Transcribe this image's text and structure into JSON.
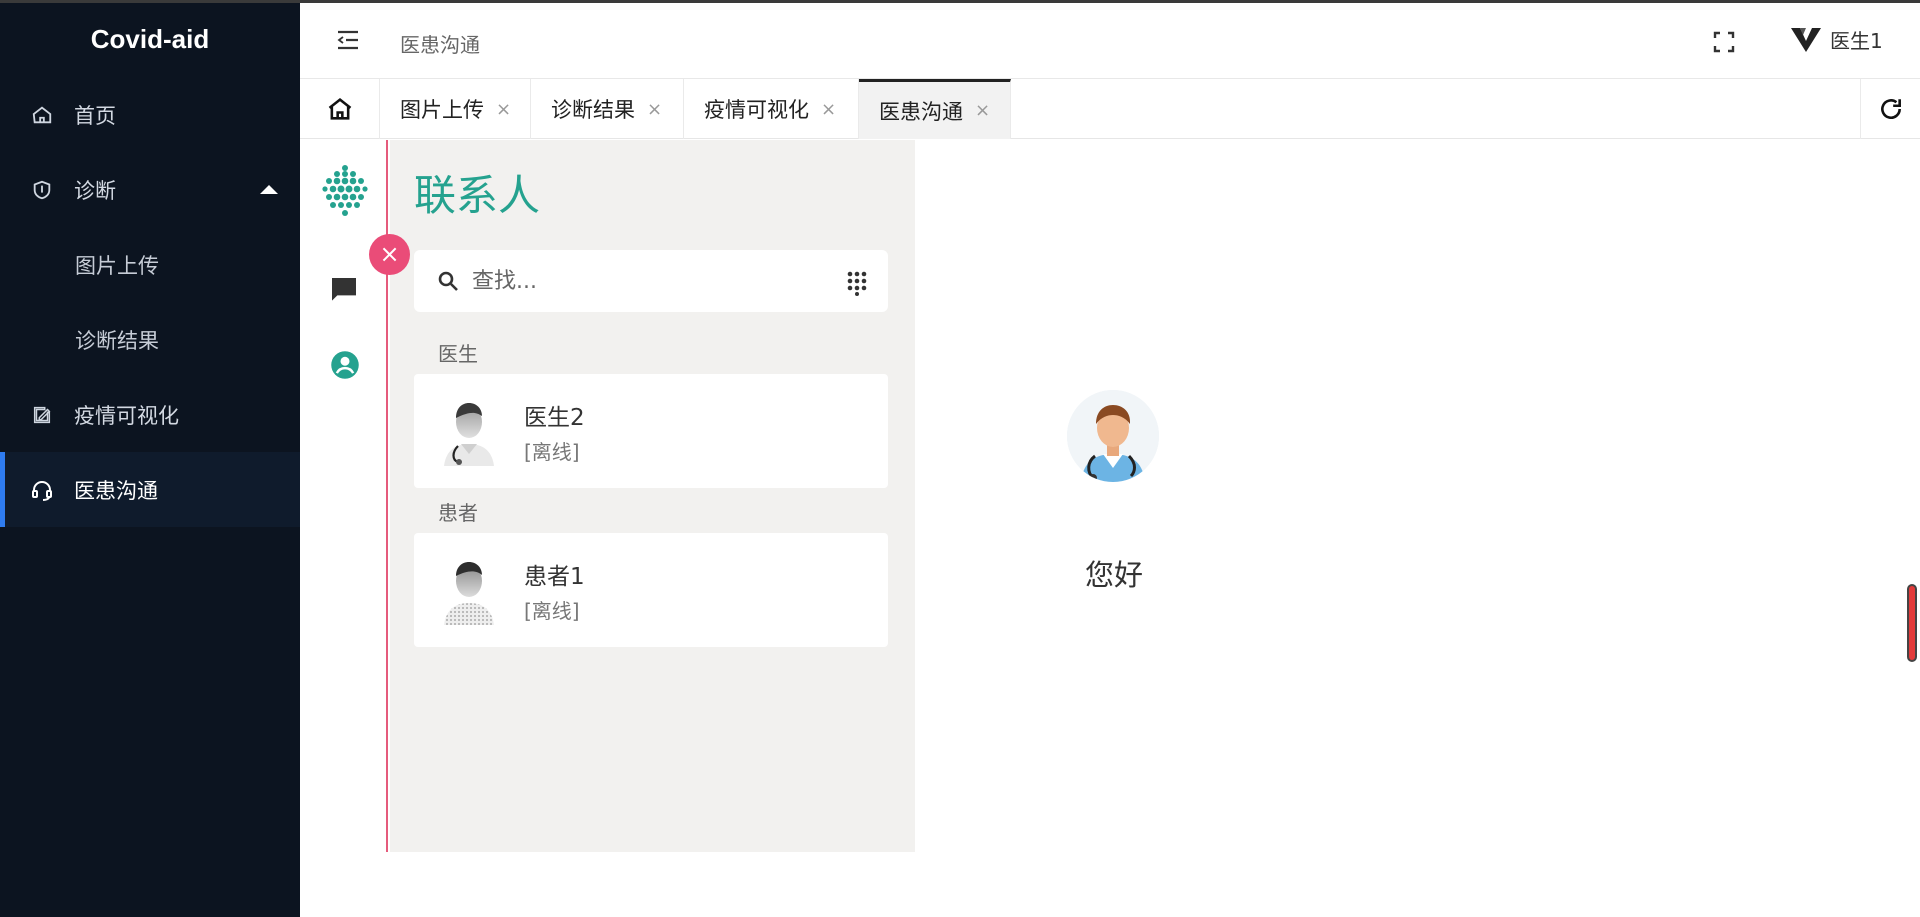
{
  "app": {
    "brand": "Covid-aid"
  },
  "sidebar": {
    "items": [
      {
        "label": "首页",
        "icon": "home-icon"
      },
      {
        "label": "诊断",
        "icon": "shield-icon",
        "expanded": true
      },
      {
        "label": "图片上传",
        "sub": true
      },
      {
        "label": "诊断结果",
        "sub": true
      },
      {
        "label": "疫情可视化",
        "icon": "chart-edit-icon"
      },
      {
        "label": "医患沟通",
        "icon": "headset-icon",
        "active": true
      }
    ]
  },
  "header": {
    "breadcrumb": "医患沟通",
    "user_name": "医生1"
  },
  "tabs": [
    {
      "label": "图片上传"
    },
    {
      "label": "诊断结果"
    },
    {
      "label": "疫情可视化"
    },
    {
      "label": "医患沟通",
      "active": true
    }
  ],
  "tab_close_glyph": "×",
  "chat": {
    "contacts_title": "联系人",
    "search_placeholder": "查找...",
    "groups": [
      {
        "label": "医生",
        "contacts": [
          {
            "name": "医生2",
            "status": "[离线]"
          }
        ]
      },
      {
        "label": "患者",
        "contacts": [
          {
            "name": "患者1",
            "status": "[离线]"
          }
        ]
      }
    ],
    "greeting": "您好",
    "close_glyph": "×"
  },
  "colors": {
    "sidebar_bg": "#0c1420",
    "accent_teal": "#25a28f",
    "accent_pink": "#ea4c78",
    "active_indicator": "#2f7cf0"
  }
}
